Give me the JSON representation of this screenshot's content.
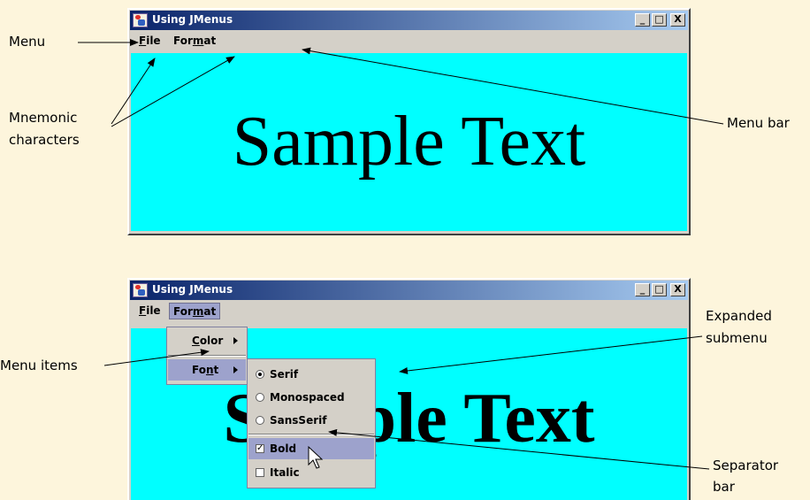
{
  "annotations": {
    "menu": "Menu",
    "mnemonic_line1": "Mnemonic",
    "mnemonic_line2": "characters",
    "menu_bar": "Menu bar",
    "expanded_line1": "Expanded",
    "expanded_line2": "submenu",
    "menu_items": "Menu items",
    "separator_line1": "Separator",
    "separator_line2": "bar"
  },
  "window_top": {
    "title": "Using JMenus",
    "menus": [
      "File",
      "Format"
    ],
    "content_text": "Sample Text"
  },
  "window_bottom": {
    "title": "Using JMenus",
    "menus": [
      "File",
      "Format"
    ],
    "content_text": "Sample Text",
    "format_menu": {
      "items": [
        "Color",
        "Font"
      ]
    },
    "font_submenu": {
      "radio_items": [
        {
          "label": "Serif",
          "selected": true
        },
        {
          "label": "Monospaced",
          "selected": false
        },
        {
          "label": "SansSerif",
          "selected": false
        }
      ],
      "check_items": [
        {
          "label": "Bold",
          "checked": true
        },
        {
          "label": "Italic",
          "checked": false
        }
      ]
    }
  },
  "title_buttons": [
    "_",
    "□",
    "X"
  ],
  "colors": {
    "background": "#fdf5dc",
    "content": "#00ffff",
    "highlight": "#9da2cc",
    "titlebar_start": "#0a246a",
    "titlebar_end": "#a6caf0"
  }
}
